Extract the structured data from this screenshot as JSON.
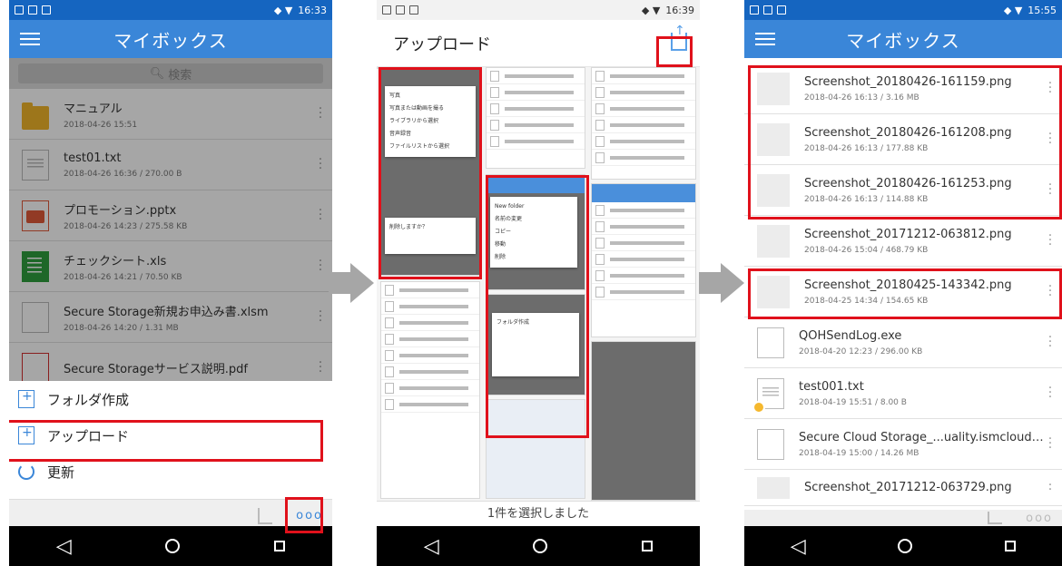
{
  "screen1": {
    "status_time": "16:33",
    "title": "マイボックス",
    "search_placeholder": "検索",
    "files": [
      {
        "name": "マニュアル",
        "meta": "2018-04-26 15:51",
        "icon": "folder-icon"
      },
      {
        "name": "test01.txt",
        "meta": "2018-04-26 16:36 / 270.00 B",
        "icon": "text-file-icon"
      },
      {
        "name": "プロモーション.pptx",
        "meta": "2018-04-26 14:23 / 275.58 KB",
        "icon": "pptx-file-icon"
      },
      {
        "name": "チェックシート.xls",
        "meta": "2018-04-26 14:21 / 70.50 KB",
        "icon": "xls-file-icon"
      },
      {
        "name": "Secure Storage新規お申込み書.xlsm",
        "meta": "2018-04-26 14:20 / 1.31 MB",
        "icon": "file-icon"
      },
      {
        "name": "Secure Storageサービス説明.pdf",
        "meta": "",
        "icon": "pdf-file-icon"
      }
    ],
    "sheet": {
      "create_folder": "フォルダ作成",
      "upload": "アップロード",
      "refresh": "更新"
    },
    "more_label": "ooo"
  },
  "screen2": {
    "status_time": "16:39",
    "title": "アップロード",
    "selected_text": "1件を選択しました",
    "menu_a": [
      "写真",
      "写真または動画を撮る",
      "ライブラリから選択",
      "音声録音",
      "ファイルリストから選択"
    ],
    "menu_b": [
      "New folder",
      "名前の変更",
      "コピー",
      "移動",
      "削除"
    ],
    "dialog_title": "フォルダ作成",
    "delete_prompt": "削除しますか？"
  },
  "screen3": {
    "status_time": "15:55",
    "title": "マイボックス",
    "files": [
      {
        "name": "Screenshot_20180426-161159.png",
        "meta": "2018-04-26 16:13 / 3.16 MB",
        "icon": "image-thumbnail"
      },
      {
        "name": "Screenshot_20180426-161208.png",
        "meta": "2018-04-26 16:13 / 177.88 KB",
        "icon": "image-thumbnail"
      },
      {
        "name": "Screenshot_20180426-161253.png",
        "meta": "2018-04-26 16:13 / 114.88 KB",
        "icon": "image-thumbnail"
      },
      {
        "name": "Screenshot_20171212-063812.png",
        "meta": "2018-04-26 15:04 / 468.79 KB",
        "icon": "image-thumbnail"
      },
      {
        "name": "Screenshot_20180425-143342.png",
        "meta": "2018-04-25 14:34 / 154.65 KB",
        "icon": "image-thumbnail"
      },
      {
        "name": "QOHSendLog.exe",
        "meta": "2018-04-20 12:23 / 296.00 KB",
        "icon": "file-icon"
      },
      {
        "name": "test001.txt",
        "meta": "2018-04-19 15:51 / 8.00 B",
        "icon": "text-file-icon"
      },
      {
        "name": "Secure Cloud Storage_...uality.ismcloudscs.apk",
        "meta": "2018-04-19 15:00 / 14.26 MB",
        "icon": "file-icon"
      },
      {
        "name": "Screenshot_20171212-063729.png",
        "meta": "",
        "icon": "image-thumbnail"
      }
    ],
    "more_label": "ooo"
  },
  "colors": {
    "appbar": "#3a86d8",
    "highlight": "#e0111b",
    "arrow": "#a6a6a6"
  }
}
